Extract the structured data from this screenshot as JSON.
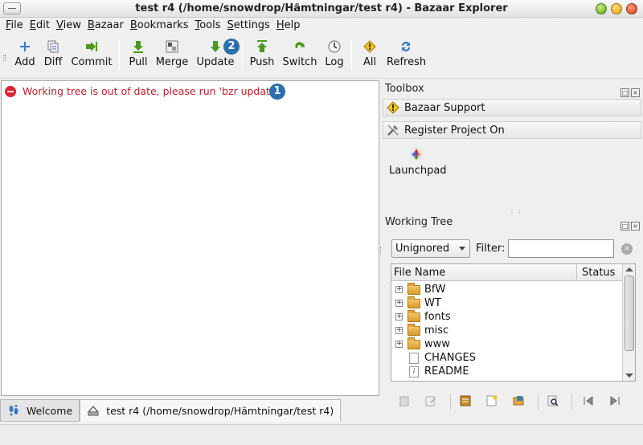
{
  "window": {
    "title": "test r4 (/home/snowdrop/Hämtningar/test r4) - Bazaar Explorer"
  },
  "menubar": [
    "File",
    "Edit",
    "View",
    "Bazaar",
    "Bookmarks",
    "Tools",
    "Settings",
    "Help"
  ],
  "toolbar": {
    "add": "Add",
    "diff": "Diff",
    "commit": "Commit",
    "pull": "Pull",
    "merge": "Merge",
    "update": "Update",
    "push": "Push",
    "switch": "Switch",
    "log": "Log",
    "all": "All",
    "refresh": "Refresh"
  },
  "badges": {
    "one": "1",
    "two": "2"
  },
  "main": {
    "warning": "Working tree is out of date, please run 'bzr update'."
  },
  "tabs": {
    "welcome": "Welcome",
    "branch": "test r4 (/home/snowdrop/Hämtningar/test r4)"
  },
  "toolbox": {
    "title": "Toolbox",
    "bazaar_support": "Bazaar Support",
    "register_project": "Register Project On",
    "launchpad": "Launchpad"
  },
  "working_tree": {
    "title": "Working Tree",
    "filter_select": "Unignored",
    "filter_label": "Filter:",
    "filter_value": "",
    "columns": [
      "File Name",
      "Status"
    ],
    "rows": [
      {
        "name": "BfW",
        "type": "folder"
      },
      {
        "name": "WT",
        "type": "folder"
      },
      {
        "name": "fonts",
        "type": "folder"
      },
      {
        "name": "misc",
        "type": "folder"
      },
      {
        "name": "www",
        "type": "folder"
      },
      {
        "name": "CHANGES",
        "type": "file"
      },
      {
        "name": "README",
        "type": "info"
      }
    ]
  },
  "colors": {
    "warning_text": "#c0202a",
    "badge_bg": "#2a6fae",
    "arrow_green": "#4a9a1e"
  }
}
